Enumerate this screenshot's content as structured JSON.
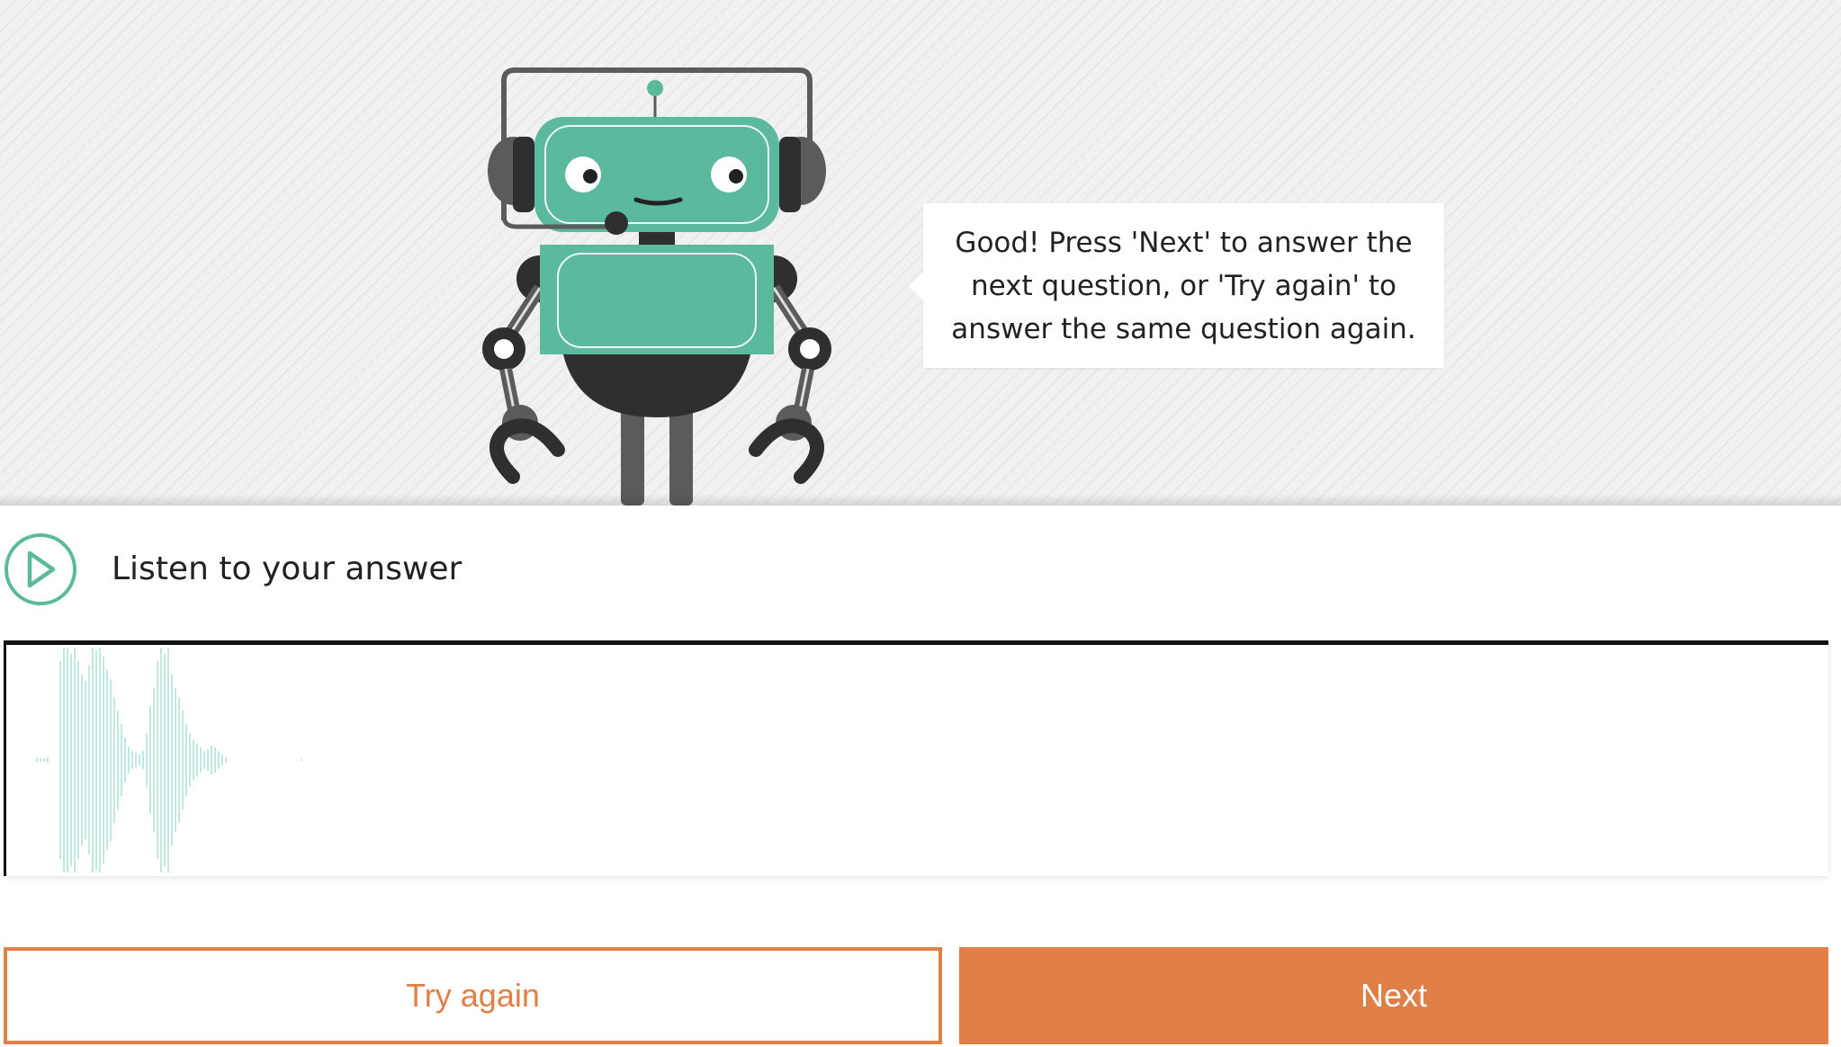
{
  "speech_bubble": {
    "text": "Good! Press 'Next' to answer the next question, or 'Try again' to answer the same question again."
  },
  "playback": {
    "label": "Listen to your answer",
    "icon": "play-icon"
  },
  "buttons": {
    "try_again_label": "Try again",
    "next_label": "Next"
  },
  "colors": {
    "accent_teal": "#5bb99d",
    "accent_orange": "#e07f46",
    "waveform": "#bfe9e0"
  }
}
